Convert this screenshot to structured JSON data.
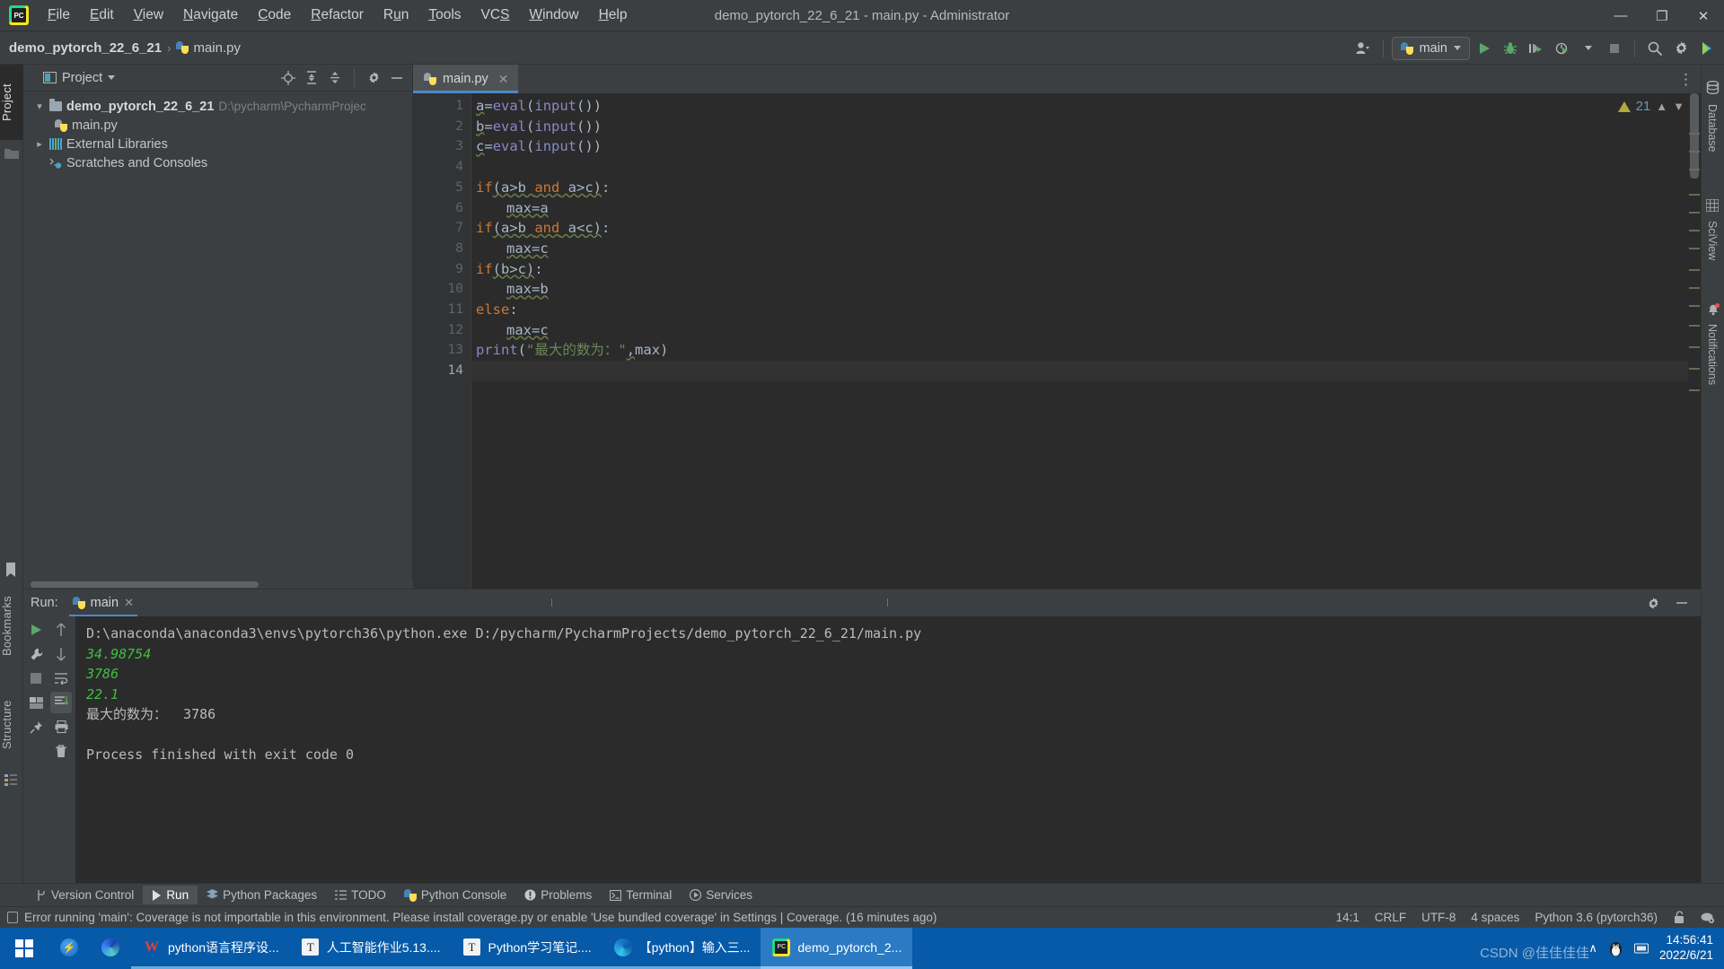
{
  "window": {
    "title": "demo_pytorch_22_6_21 - main.py - Administrator",
    "minimize": "—",
    "maximize": "❐",
    "close": "✕"
  },
  "menubar": {
    "items": [
      {
        "label": "File"
      },
      {
        "label": "Edit"
      },
      {
        "label": "View"
      },
      {
        "label": "Navigate"
      },
      {
        "label": "Code"
      },
      {
        "label": "Refactor"
      },
      {
        "label": "Run"
      },
      {
        "label": "Tools"
      },
      {
        "label": "VCS"
      },
      {
        "label": "Window"
      },
      {
        "label": "Help"
      }
    ]
  },
  "breadcrumb": {
    "project": "demo_pytorch_22_6_21",
    "separator": "›",
    "file": "main.py"
  },
  "toolbar": {
    "run_config": "main",
    "icons": [
      "account-icon",
      "run-icon",
      "debug-icon",
      "coverage-icon",
      "profile-icon",
      "stop-icon",
      "search-icon",
      "settings-icon",
      "ide-assistant-icon"
    ]
  },
  "left_rail": {
    "tabs": [
      {
        "label": "Project",
        "selected": true
      },
      {
        "label": "Bookmarks",
        "selected": false
      },
      {
        "label": "Structure",
        "selected": false
      }
    ]
  },
  "right_rail": {
    "tabs": [
      {
        "label": "Database"
      },
      {
        "label": "SciView"
      },
      {
        "label": "Notifications"
      }
    ]
  },
  "project_panel": {
    "title": "Project",
    "tree": [
      {
        "name": "demo_pytorch_22_6_21",
        "path": "D:\\pycharm\\PycharmProjec",
        "type": "folder",
        "expanded": true,
        "depth": 0
      },
      {
        "name": "main.py",
        "path": "",
        "type": "python",
        "depth": 1
      },
      {
        "name": "External Libraries",
        "path": "",
        "type": "library",
        "expanded": false,
        "depth": 0
      },
      {
        "name": "Scratches and Consoles",
        "path": "",
        "type": "scratch",
        "depth": 0
      }
    ]
  },
  "editor": {
    "tab": {
      "label": "main.py",
      "close": "✕"
    },
    "warning_count": "21",
    "lines": [
      {
        "num": "1",
        "text": "a=eval(input())"
      },
      {
        "num": "2",
        "text": "b=eval(input())"
      },
      {
        "num": "3",
        "text": "c=eval(input())"
      },
      {
        "num": "4",
        "text": ""
      },
      {
        "num": "5",
        "text": "if(a>b and a>c):"
      },
      {
        "num": "6",
        "text": "    max=a"
      },
      {
        "num": "7",
        "text": "if(a>b and a<c):"
      },
      {
        "num": "8",
        "text": "    max=c"
      },
      {
        "num": "9",
        "text": "if(b>c):"
      },
      {
        "num": "10",
        "text": "    max=b"
      },
      {
        "num": "11",
        "text": "else:"
      },
      {
        "num": "12",
        "text": "    max=c"
      },
      {
        "num": "13",
        "text": "print(\"最大的数为：\",max)"
      },
      {
        "num": "14",
        "text": ""
      }
    ]
  },
  "run_panel": {
    "label": "Run:",
    "tab": "main",
    "tab_close": "✕",
    "console": [
      {
        "text": "D:\\anaconda\\anaconda3\\envs\\pytorch36\\python.exe D:/pycharm/PycharmProjects/demo_pytorch_22_6_21/main.py",
        "style": "normal"
      },
      {
        "text": "34.98754",
        "style": "green"
      },
      {
        "text": "3786",
        "style": "green"
      },
      {
        "text": "22.1",
        "style": "green"
      },
      {
        "text": "最大的数为：  3786",
        "style": "normal"
      },
      {
        "text": "",
        "style": "normal"
      },
      {
        "text": "Process finished with exit code 0",
        "style": "normal"
      }
    ]
  },
  "bottom_tabs": [
    {
      "label": "Version Control",
      "icon": "branch-icon",
      "selected": false
    },
    {
      "label": "Run",
      "icon": "play-icon",
      "selected": true
    },
    {
      "label": "Python Packages",
      "icon": "packages-icon",
      "selected": false
    },
    {
      "label": "TODO",
      "icon": "list-icon",
      "selected": false
    },
    {
      "label": "Python Console",
      "icon": "python-icon",
      "selected": false
    },
    {
      "label": "Problems",
      "icon": "problems-icon",
      "selected": false
    },
    {
      "label": "Terminal",
      "icon": "terminal-icon",
      "selected": false
    },
    {
      "label": "Services",
      "icon": "services-icon",
      "selected": false
    }
  ],
  "statusbar": {
    "message": "Error running 'main': Coverage is not importable in this environment. Please install coverage.py or enable 'Use bundled coverage' in Settings | Coverage. (16 minutes ago)",
    "caret": "14:1",
    "line_sep": "CRLF",
    "encoding": "UTF-8",
    "indent": "4 spaces",
    "interpreter": "Python 3.6 (pytorch36)"
  },
  "taskbar": {
    "items": [
      {
        "label": "",
        "icon": "start-icon",
        "state": "none"
      },
      {
        "label": "",
        "icon": "tim-icon",
        "state": "none"
      },
      {
        "label": "",
        "icon": "edge-icon",
        "state": "none"
      },
      {
        "label": "python语言程序设...",
        "icon": "wps-icon",
        "state": "open"
      },
      {
        "label": "人工智能作业5.13....",
        "icon": "text-icon",
        "state": "open"
      },
      {
        "label": "Python学习笔记....",
        "icon": "text-icon",
        "state": "open"
      },
      {
        "label": "【python】输入三...",
        "icon": "edge-icon",
        "state": "open"
      },
      {
        "label": "demo_pytorch_2...",
        "icon": "pycharm-icon",
        "state": "active"
      }
    ],
    "tray": {
      "chevron": "∧",
      "time": "14:56:41",
      "date": "2022/6/21"
    },
    "watermark": "CSDN @佳佳佳佳"
  }
}
